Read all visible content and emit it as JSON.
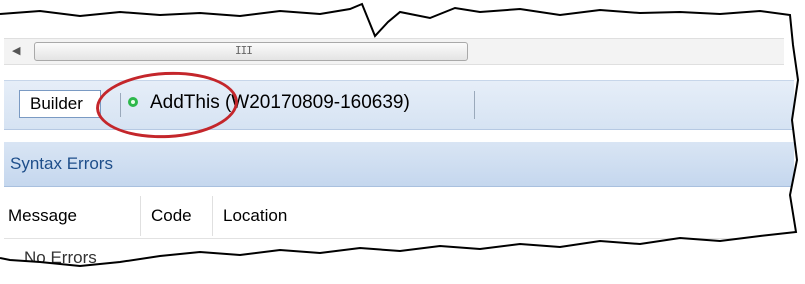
{
  "scrollbar": {
    "left_arrow": "◀",
    "grip": "III"
  },
  "toolbar": {
    "builder_tab_label": "Builder",
    "project_name": "AddThis (W20170809-160639)",
    "status_color": "#2db84b"
  },
  "syntax_errors_panel": {
    "title": "Syntax Errors",
    "columns": [
      "Message",
      "Code",
      "Location"
    ],
    "rows": [
      "No Errors"
    ]
  },
  "annotation": {
    "shape": "ellipse",
    "color": "#c4262b"
  }
}
